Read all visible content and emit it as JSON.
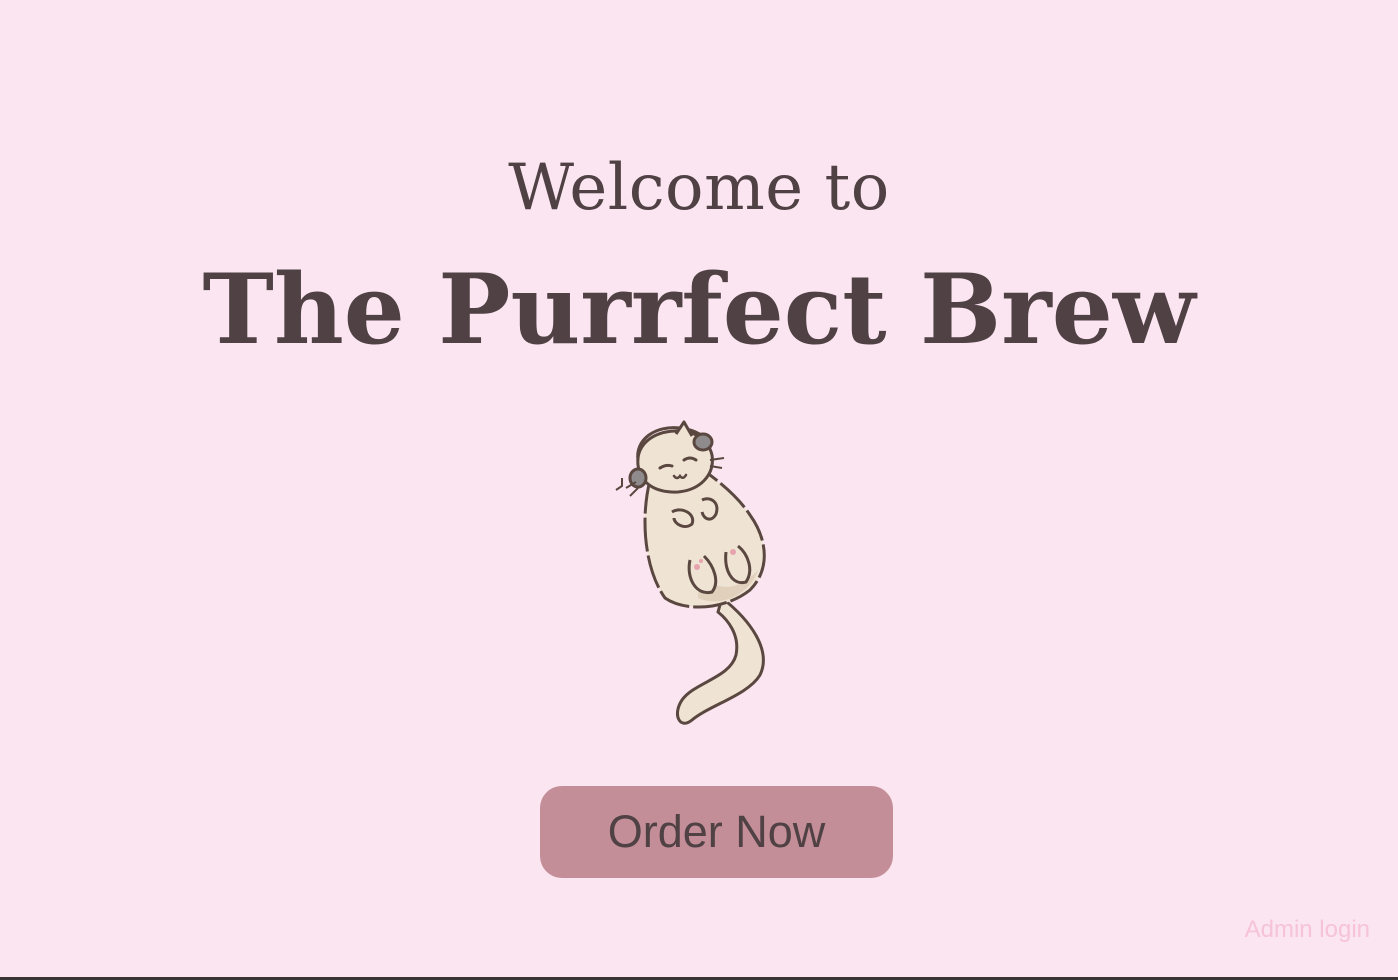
{
  "hero": {
    "welcome_text": "Welcome to",
    "title": "The Purrfect Brew",
    "mascot_icon": "sleeping-cat-illustration"
  },
  "actions": {
    "order_label": "Order Now",
    "admin_label": "Admin login"
  },
  "colors": {
    "background": "#fae5f0",
    "text": "#4f4144",
    "button": "#c38e98",
    "admin_link": "#f6c3d9"
  }
}
